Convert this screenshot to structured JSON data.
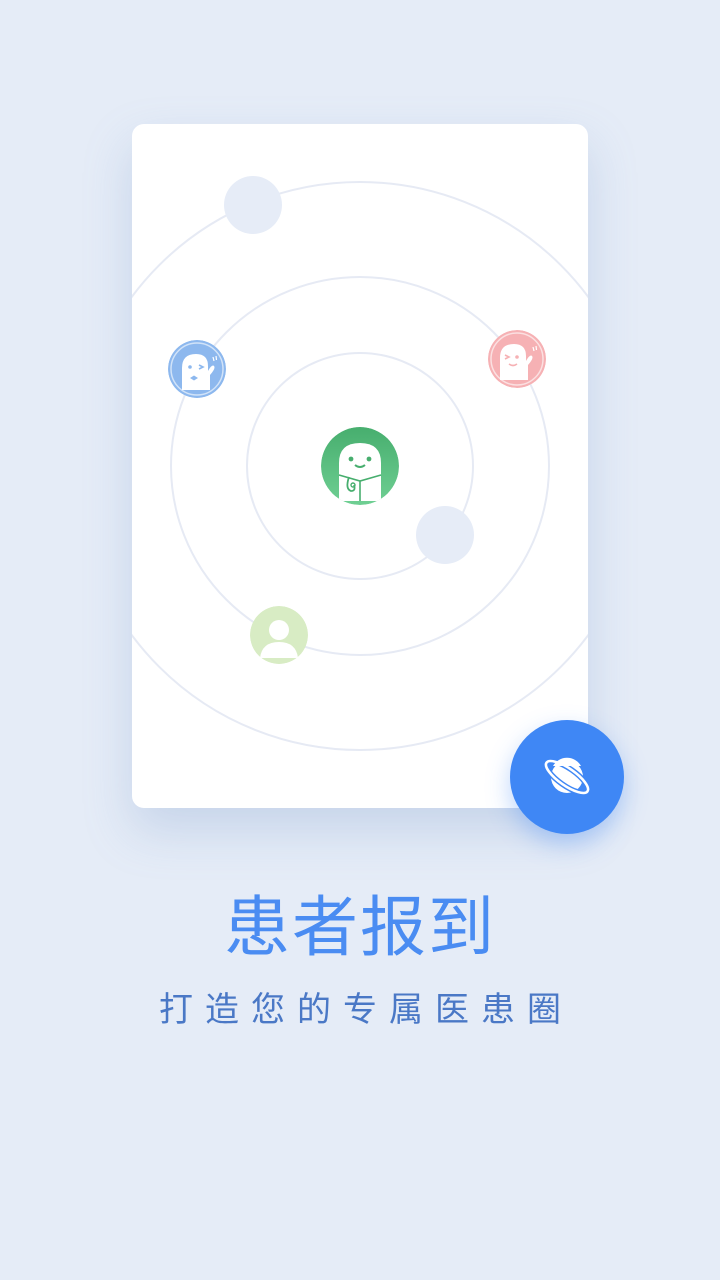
{
  "onboarding": {
    "title": "患者报到",
    "subtitle": "打造您的专属医患圈"
  },
  "icons": {
    "fab": "planet-icon",
    "center_avatar": "doctor-mascot-icon",
    "blue_avatar": "waving-mascot-icon",
    "pink_avatar": "waving-mascot-icon",
    "green_avatar": "user-silhouette-icon"
  },
  "colors": {
    "background": "#e5ecf7",
    "accent": "#3f87f5",
    "title": "#4a8cf2",
    "subtitle": "#4a78c6",
    "doctor_green": "#4cb57a",
    "patient_blue": "#8db8ee",
    "patient_pink": "#f6b1b4",
    "patient_green": "#d8ecc4"
  }
}
